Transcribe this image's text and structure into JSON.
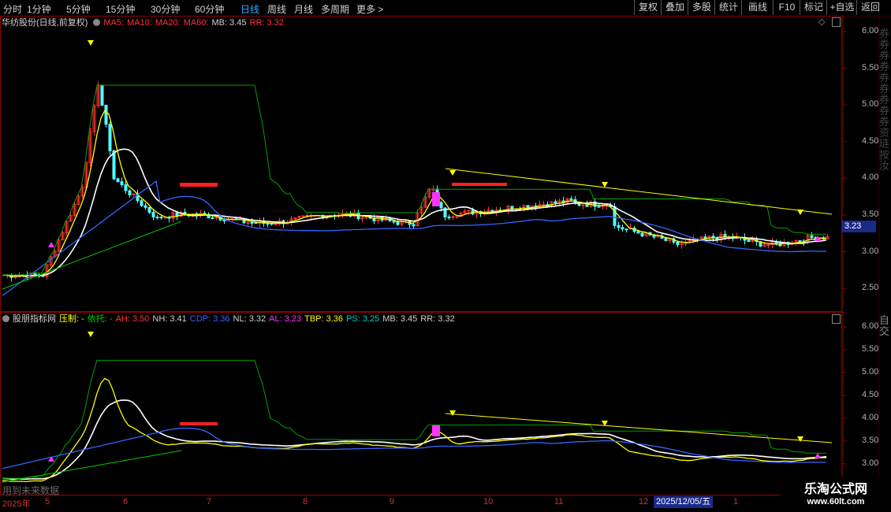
{
  "toolbar": {
    "periods": [
      "分时",
      "1分钟",
      "5分钟",
      "15分钟",
      "30分钟",
      "60分钟",
      "日线",
      "周线",
      "月线",
      "多周期",
      "更多 >"
    ],
    "buttons": [
      "复权",
      "叠加",
      "多股",
      "统计",
      "画线",
      "F10",
      "标记",
      "+自选",
      "返回"
    ]
  },
  "main_chart": {
    "title": "华纺股份(日线,前复权)",
    "legend": {
      "ma5": "MA5:",
      "ma10": "MA10:",
      "ma20": "MA20:",
      "ma60": "MA60:",
      "mb": "MB: 3.45",
      "rr": "RR: 3.32"
    },
    "price_tag": "3.23",
    "right_strip_text": "券券券券券券券券券资琏按汝"
  },
  "indicator": {
    "title": "股朋指标网",
    "items": [
      {
        "text": "压制: -",
        "color": "#ffff00"
      },
      {
        "text": "依托: -",
        "color": "#00cc00"
      },
      {
        "text": "AH: 3.50",
        "color": "#ff3333"
      },
      {
        "text": "NH: 3.41",
        "color": "#d0d0d0"
      },
      {
        "text": "CDP: 3.36",
        "color": "#3366ff"
      },
      {
        "text": "NL: 3.32",
        "color": "#d0d0d0"
      },
      {
        "text": "AL: 3.23",
        "color": "#ff33ff"
      },
      {
        "text": "TBP: 3.36",
        "color": "#ffff00"
      },
      {
        "text": "PS: 3.25",
        "color": "#00cccc"
      },
      {
        "text": "MB: 3.45",
        "color": "#d0d0d0"
      },
      {
        "text": "RR: 3.32",
        "color": "#d0d0d0"
      }
    ],
    "right_strip_text": "自交"
  },
  "y_axis_main": [
    "6.00",
    "5.50",
    "5.00",
    "4.50",
    "4.00",
    "3.50",
    "3.00",
    "2.50"
  ],
  "y_axis_indicator": [
    "6.00",
    "5.50",
    "5.00",
    "4.50",
    "4.00",
    "3.50",
    "3.00"
  ],
  "x_axis": {
    "labels": [
      "2025年",
      "5",
      "6",
      "7",
      "8",
      "9",
      "10",
      "11",
      "12",
      "1"
    ],
    "cursor_date": "2025/12/05/五"
  },
  "watermark": "用到未来数据",
  "logo": {
    "name": "乐淘公式网",
    "url": "www.60lt.com"
  },
  "colors": {
    "up": "#ff3232",
    "down": "#54fcfc",
    "ma_white": "#ffffff",
    "ma_yellow": "#ffff00",
    "ma_green": "#00a000",
    "ma_blue": "#3366ff"
  }
}
